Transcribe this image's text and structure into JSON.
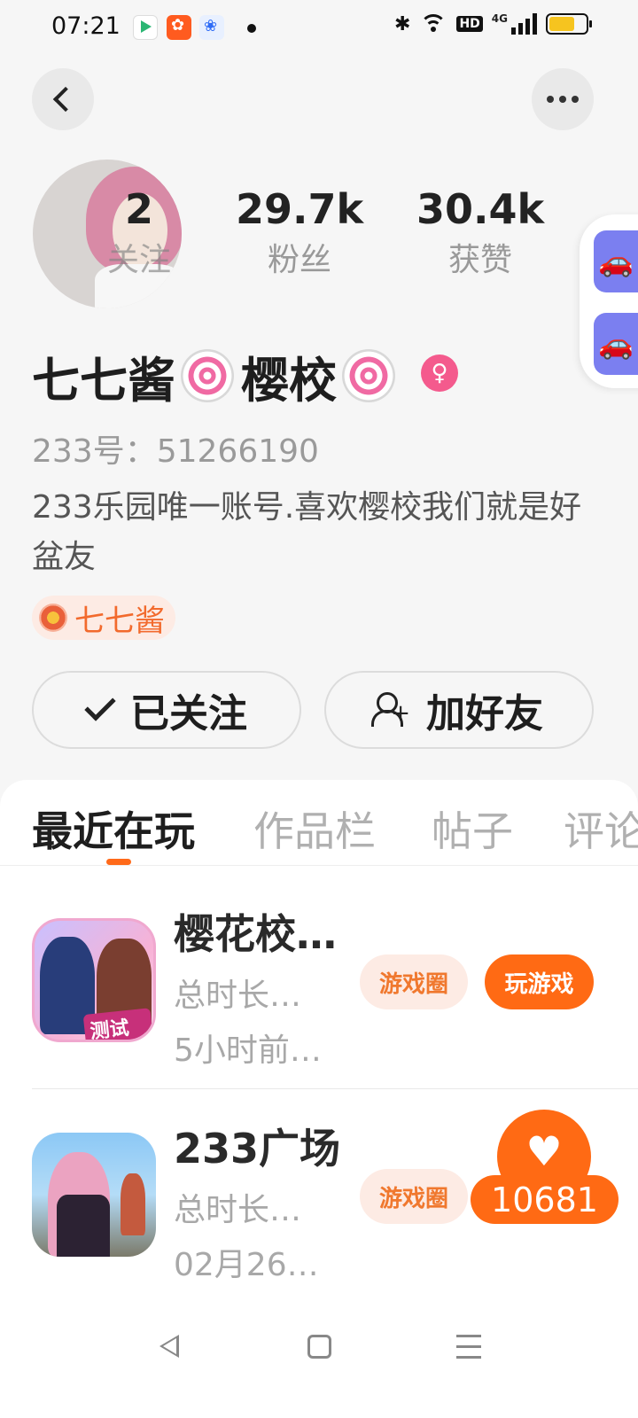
{
  "status_bar": {
    "time": "07:21",
    "icons": [
      "video-app-icon",
      "kuaishou-app-icon",
      "baidu-app-icon",
      "notification-dot",
      "bluetooth-icon",
      "wifi-icon",
      "hd-icon",
      "4g-signal-icon",
      "battery-icon"
    ],
    "hd_label": "HD",
    "network_label": "4G",
    "bluetooth_glyph": "✱"
  },
  "profile": {
    "stats": [
      {
        "value": "2",
        "label": "关注"
      },
      {
        "value": "29.7k",
        "label": "粉丝"
      },
      {
        "value": "30.4k",
        "label": "获赞"
      }
    ],
    "name_part1": "七七酱",
    "name_part2": "樱校",
    "gender_glyph": "♀",
    "account": "233号：51266190",
    "bio": "233乐园唯一账号.喜欢樱校我们就是好盆友",
    "tag": "七七酱",
    "buttons": {
      "followed": "已关注",
      "add_friend": "加好友"
    }
  },
  "side_actions": [
    {
      "icon": "car-icon"
    },
    {
      "icon": "car-icon"
    }
  ],
  "tabs": [
    {
      "label": "最近在玩",
      "active": true
    },
    {
      "label": "作品栏",
      "active": false
    },
    {
      "label": "帖子",
      "active": false
    },
    {
      "label": "评论",
      "active": false
    }
  ],
  "games": [
    {
      "title": "樱花校…",
      "duration": "总时长…",
      "last_played": "5小时前…",
      "badge": "测试版",
      "circle_btn": "游戏圈",
      "play_btn": "玩游戏"
    },
    {
      "title": "233广场",
      "duration": "总时长…",
      "last_played": "02月26…",
      "circle_btn": "游戏圈"
    }
  ],
  "floating_like": {
    "count": "10681"
  },
  "colors": {
    "accent": "#ff6a14",
    "tag_bg": "#fdebe4",
    "gender": "#f45a8d",
    "side_button": "#7b7ff0"
  }
}
